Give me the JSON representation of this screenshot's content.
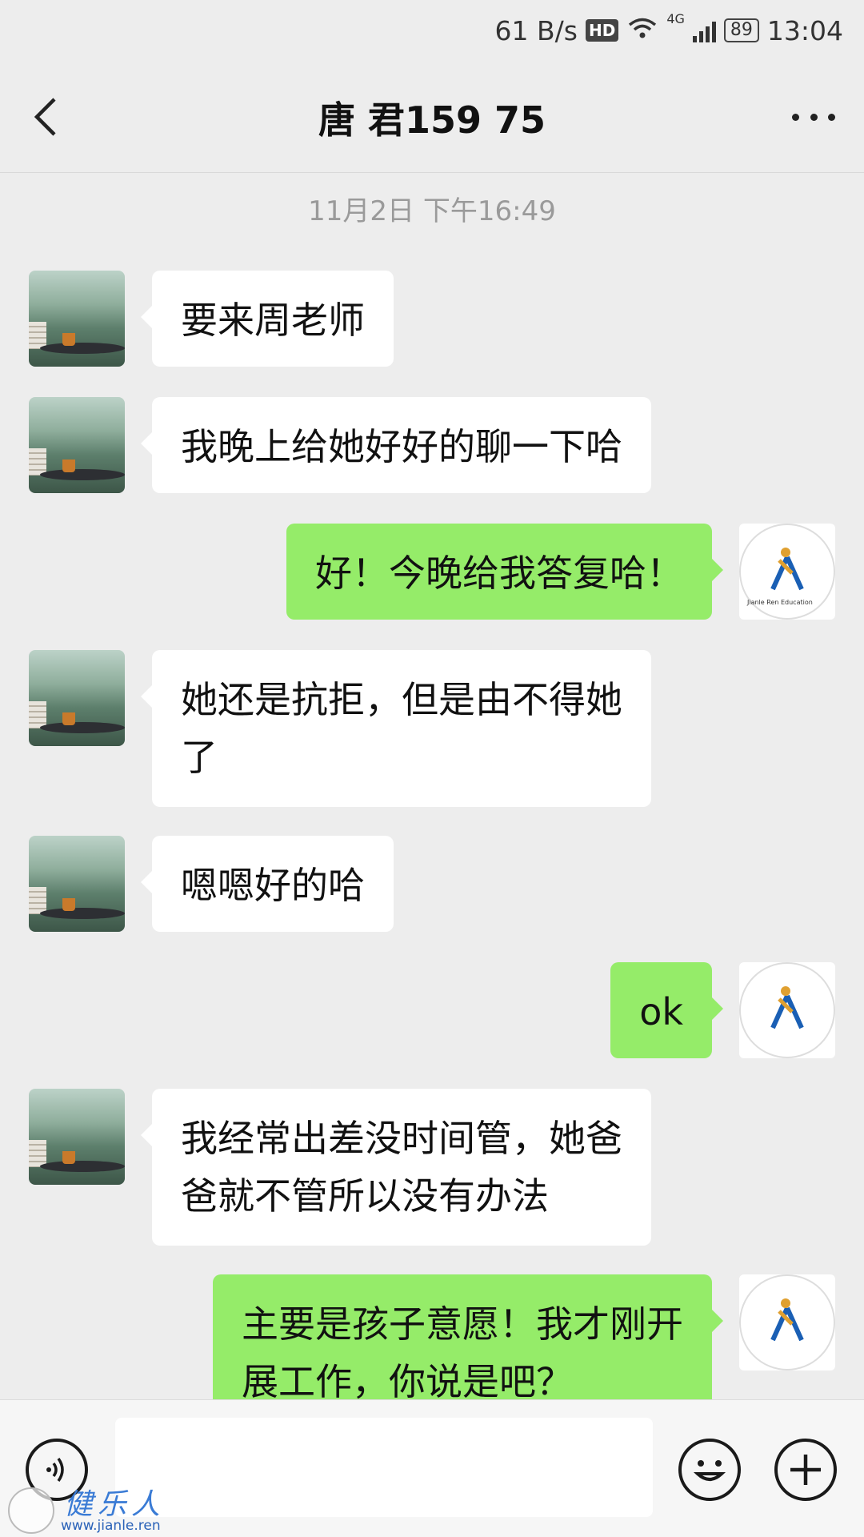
{
  "status_bar": {
    "speed": "61 B/s",
    "hd": "HD",
    "network": "4G",
    "battery": "89",
    "time": "13:04"
  },
  "header": {
    "title": "唐 君159 75",
    "back_icon": "chevron-left-icon",
    "more_icon": "more-dots-icon"
  },
  "timestamp": "11月2日 下午16:49",
  "messages": [
    {
      "side": "in",
      "text": "要来周老师"
    },
    {
      "side": "in",
      "text": "我晚上给她好好的聊一下哈"
    },
    {
      "side": "out",
      "text": "好！今晚给我答复哈！"
    },
    {
      "side": "in",
      "line1": "她还是抗拒，但是由不得她",
      "line2": "了"
    },
    {
      "side": "in",
      "text": "嗯嗯好的哈"
    },
    {
      "side": "out",
      "text": "ok"
    },
    {
      "side": "in",
      "line1": "我经常出差没时间管，她爸",
      "line2": "爸就不管所以没有办法"
    },
    {
      "side": "out",
      "line1": "主要是孩子意愿！我才刚开",
      "line2": "展工作，你说是吧？"
    }
  ],
  "logo_text": "Jianle Ren Education",
  "input_bar": {
    "voice_icon": "voice-icon",
    "emoji_icon": "emoji-icon",
    "plus_icon": "plus-icon"
  },
  "watermark": {
    "name": "健乐人",
    "url": "www.jianle.ren"
  }
}
